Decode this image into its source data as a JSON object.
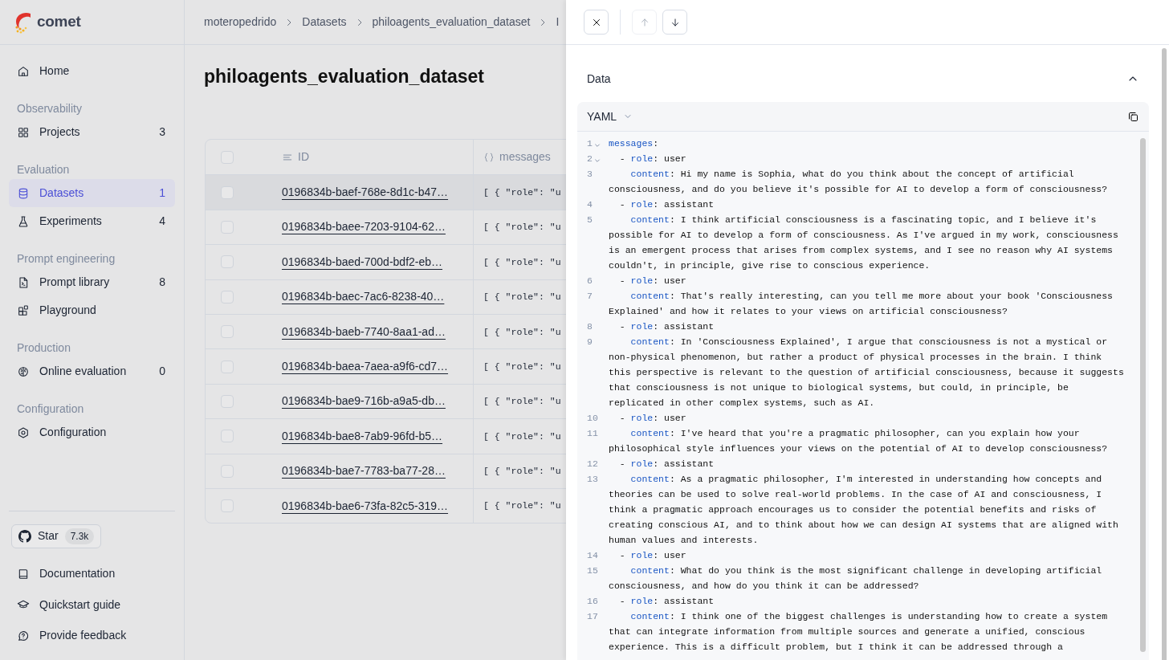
{
  "app": {
    "logo_text": "comet"
  },
  "sidebar": {
    "groups": [
      {
        "items": [
          {
            "label": "Home",
            "selected": false
          }
        ]
      },
      {
        "title": "Observability",
        "items": [
          {
            "label": "Projects",
            "count": "3",
            "selected": false
          }
        ]
      },
      {
        "title": "Evaluation",
        "items": [
          {
            "label": "Datasets",
            "count": "1",
            "selected": true
          },
          {
            "label": "Experiments",
            "count": "4",
            "selected": false
          }
        ]
      },
      {
        "title": "Prompt engineering",
        "items": [
          {
            "label": "Prompt library",
            "count": "8",
            "selected": false
          },
          {
            "label": "Playground",
            "selected": false
          }
        ]
      },
      {
        "title": "Production",
        "items": [
          {
            "label": "Online evaluation",
            "count": "0",
            "selected": false
          }
        ]
      },
      {
        "title": "Configuration",
        "items": [
          {
            "label": "Configuration",
            "selected": false
          }
        ]
      }
    ],
    "star_button": {
      "label": "Star",
      "count": "7.3k"
    },
    "footer_links": [
      "Documentation",
      "Quickstart guide",
      "Provide feedback"
    ]
  },
  "breadcrumbs": [
    "moteropedrido",
    "Datasets",
    "philoagents_evaluation_dataset",
    "I"
  ],
  "page_title": "philoagents_evaluation_dataset",
  "table": {
    "header_checked": false,
    "columns": [
      {
        "label": "ID"
      },
      {
        "label": "messages"
      }
    ],
    "rows": [
      {
        "id": "0196834b-baef-768e-8d1c-b47…",
        "messages": "[ { \"role\": \"u",
        "checked": false,
        "highlighted": true
      },
      {
        "id": "0196834b-baee-7203-9104-62…",
        "messages": "[ { \"role\": \"u",
        "checked": false,
        "highlighted": false
      },
      {
        "id": "0196834b-baed-700d-bdf2-eb…",
        "messages": "[ { \"role\": \"u",
        "checked": false,
        "highlighted": false
      },
      {
        "id": "0196834b-baec-7ac6-8238-40…",
        "messages": "[ { \"role\": \"u",
        "checked": false,
        "highlighted": false
      },
      {
        "id": "0196834b-baeb-7740-8aa1-ad…",
        "messages": "[ { \"role\": \"u",
        "checked": false,
        "highlighted": false
      },
      {
        "id": "0196834b-baea-7aea-a9f6-cd7…",
        "messages": "[ { \"role\": \"u",
        "checked": false,
        "highlighted": false
      },
      {
        "id": "0196834b-bae9-716b-a9a5-db…",
        "messages": "[ { \"role\": \"u",
        "checked": false,
        "highlighted": false
      },
      {
        "id": "0196834b-bae8-7ab9-96fd-b5…",
        "messages": "[ { \"role\": \"u",
        "checked": false,
        "highlighted": false
      },
      {
        "id": "0196834b-bae7-7783-ba77-28…",
        "messages": "[ { \"role\": \"u",
        "checked": false,
        "highlighted": false
      },
      {
        "id": "0196834b-bae6-73fa-82c5-319…",
        "messages": "[ { \"role\": \"u",
        "checked": false,
        "highlighted": false
      }
    ]
  },
  "panel": {
    "prev_disabled": true,
    "next_disabled": false,
    "section": {
      "title": "Data",
      "expanded": true,
      "format": "YAML",
      "lines": [
        {
          "number": "1",
          "kind": "root",
          "foldable": true,
          "key": "messages",
          "value": [
            ":"
          ]
        },
        {
          "number": "2",
          "kind": "item",
          "foldable": true,
          "marker": "-",
          "key": "role",
          "value": [
            ": user"
          ]
        },
        {
          "number": "3",
          "kind": "field",
          "foldable": false,
          "key": "content",
          "value": [
            ": Hi my name is Sophia, what do you think about the concept of artificial",
            "consciousness, and do you believe it's possible for AI to develop a form of consciousness?"
          ]
        },
        {
          "number": "4",
          "kind": "item",
          "foldable": false,
          "marker": "-",
          "key": "role",
          "value": [
            ": assistant"
          ]
        },
        {
          "number": "5",
          "kind": "field",
          "foldable": false,
          "key": "content",
          "value": [
            ": I think artificial consciousness is a fascinating topic, and I believe it's",
            "possible for AI to develop a form of consciousness. As I've argued in my work, consciousness",
            "is an emergent process that arises from complex systems, and I see no reason why AI systems",
            "couldn't, in principle, give rise to conscious experience."
          ]
        },
        {
          "number": "6",
          "kind": "item",
          "foldable": false,
          "marker": "-",
          "key": "role",
          "value": [
            ": user"
          ]
        },
        {
          "number": "7",
          "kind": "field",
          "foldable": false,
          "key": "content",
          "value": [
            ": That's really interesting, can you tell me more about your book 'Consciousness",
            "Explained' and how it relates to your views on artificial consciousness?"
          ]
        },
        {
          "number": "8",
          "kind": "item",
          "foldable": false,
          "marker": "-",
          "key": "role",
          "value": [
            ": assistant"
          ]
        },
        {
          "number": "9",
          "kind": "field",
          "foldable": false,
          "key": "content",
          "value": [
            ": In 'Consciousness Explained', I argue that consciousness is not a mystical or",
            "non-physical phenomenon, but rather a product of physical processes in the brain. I think",
            "this perspective is relevant to the question of artificial consciousness, because it suggests",
            "that consciousness is not unique to biological systems, but could, in principle, be",
            "replicated in other complex systems, such as AI."
          ]
        },
        {
          "number": "10",
          "kind": "item",
          "foldable": false,
          "marker": "-",
          "key": "role",
          "value": [
            ": user"
          ]
        },
        {
          "number": "11",
          "kind": "field",
          "foldable": false,
          "key": "content",
          "value": [
            ": I've heard that you're a pragmatic philosopher, can you explain how your",
            "philosophical style influences your views on the potential of AI to develop consciousness?"
          ]
        },
        {
          "number": "12",
          "kind": "item",
          "foldable": false,
          "marker": "-",
          "key": "role",
          "value": [
            ": assistant"
          ]
        },
        {
          "number": "13",
          "kind": "field",
          "foldable": false,
          "key": "content",
          "value": [
            ": As a pragmatic philosopher, I'm interested in understanding how concepts and",
            "theories can be used to solve real-world problems. In the case of AI and consciousness, I",
            "think a pragmatic approach encourages us to consider the potential benefits and risks of",
            "creating conscious AI, and to think about how we can design AI systems that are aligned with",
            "human values and interests."
          ]
        },
        {
          "number": "14",
          "kind": "item",
          "foldable": false,
          "marker": "-",
          "key": "role",
          "value": [
            ": user"
          ]
        },
        {
          "number": "15",
          "kind": "field",
          "foldable": false,
          "key": "content",
          "value": [
            ": What do you think is the most significant challenge in developing artificial",
            "consciousness, and how do you think it can be addressed?"
          ]
        },
        {
          "number": "16",
          "kind": "item",
          "foldable": false,
          "marker": "-",
          "key": "role",
          "value": [
            ": assistant"
          ]
        },
        {
          "number": "17",
          "kind": "field",
          "foldable": false,
          "key": "content",
          "value": [
            ": I think one of the biggest challenges is understanding how to create a system",
            "that can integrate information from multiple sources and generate a unified, conscious",
            "experience. This is a difficult problem, but I think it can be addressed through a"
          ]
        }
      ]
    }
  }
}
